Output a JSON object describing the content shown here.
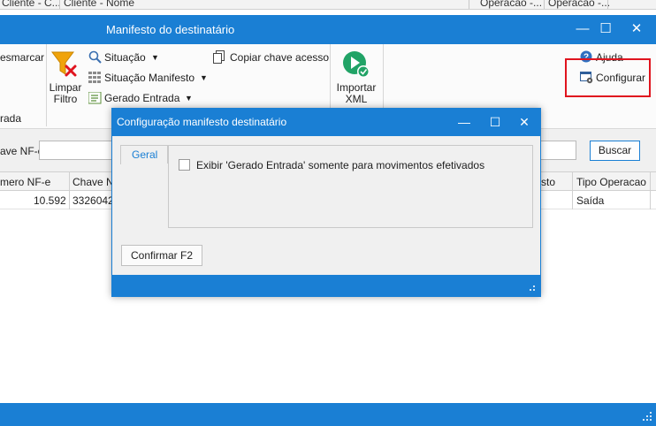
{
  "background_table": {
    "headers": [
      "Cliente - C...",
      "Cliente - Nome",
      "Operacao -...",
      "Operacao -..."
    ]
  },
  "window": {
    "title": "Manifesto do destinatário",
    "controls": {
      "minimize": "—",
      "maximize": "☐",
      "close": "✕"
    }
  },
  "ribbon": {
    "desmarcar": "esmarcar",
    "group_label": "rada",
    "limpar_filtro": [
      "Limpar",
      "Filtro"
    ],
    "situacao": "Situação",
    "situacao_manifesto": "Situação Manifesto",
    "gerado_entrada": "Gerado Entrada",
    "copiar_chave": "Copiar chave acesso",
    "importar_xml": [
      "Importar",
      "XML"
    ],
    "ajuda": "Ajuda",
    "configurar": "Configurar",
    "caret": "▼"
  },
  "search": {
    "label": "ave NF-e:",
    "value": "",
    "button": "Buscar"
  },
  "grid": {
    "headers": [
      "mero NF-e",
      "Chave N",
      "sto",
      "Tipo Operacao"
    ],
    "rows": [
      {
        "numero": "10.592",
        "chave": "3326042",
        "tipo": "Saída"
      }
    ]
  },
  "dialog": {
    "title": "Configuração manifesto destinatário",
    "controls": {
      "minimize": "—",
      "maximize": "☐",
      "close": "✕"
    },
    "tab": "Geral",
    "checkbox_label": "Exibir 'Gerado Entrada' somente para movimentos efetivados",
    "checkbox_checked": false,
    "confirm_button": "Confirmar F2"
  },
  "colors": {
    "accent": "#1a7fd4",
    "highlight": "#e0141e"
  }
}
